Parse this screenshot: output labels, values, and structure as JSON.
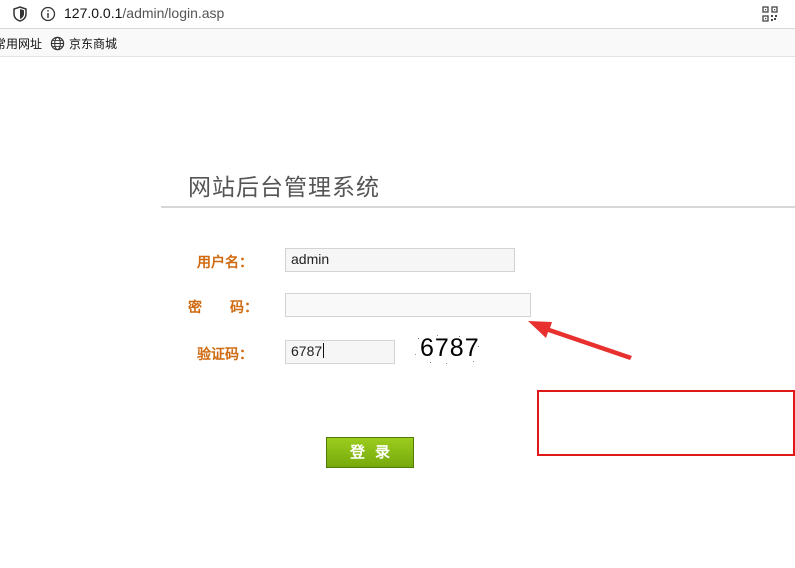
{
  "browser": {
    "url_host": "127.0.0.1",
    "url_path": "/admin/login.asp",
    "bookmarks": [
      {
        "label": "常用网址"
      },
      {
        "label": "京东商城"
      }
    ]
  },
  "login": {
    "title": "网站后台管理系统",
    "username_label": "用户名：",
    "username_value": "admin",
    "password_label": "密　　码：",
    "password_value": "",
    "captcha_label": "验证码：",
    "captcha_value": "6787",
    "captcha_image_text": "6787",
    "submit_label": "登录"
  },
  "annotations": {
    "arrow_color": "#e8302e",
    "box_color": "#e01818"
  },
  "colors": {
    "label": "#d06a10",
    "button": "#8bbf15"
  }
}
